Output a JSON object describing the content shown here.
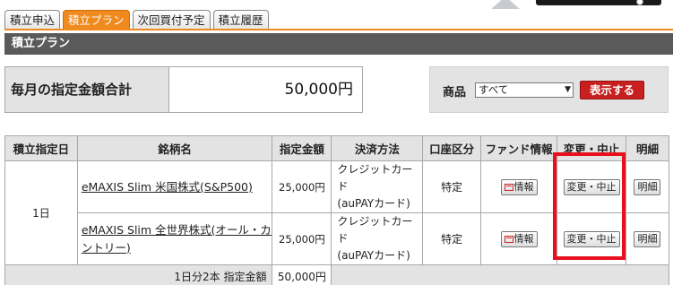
{
  "tabs": [
    {
      "label": "積立申込",
      "active": false
    },
    {
      "label": "積立プラン",
      "active": true
    },
    {
      "label": "次回買付予定",
      "active": false
    },
    {
      "label": "積立履歴",
      "active": false
    }
  ],
  "section_title": "積立プラン",
  "summary": {
    "label": "毎月の指定金額合計",
    "value": "50,000円"
  },
  "filter": {
    "label": "商品",
    "selected": "すべて",
    "button_label": "表示する"
  },
  "table": {
    "headers": [
      "積立指定日",
      "銘柄名",
      "指定金額",
      "決済方法",
      "口座区分",
      "ファンド情報",
      "変更・中止",
      "明細"
    ],
    "day": "1日",
    "rows": [
      {
        "fund": "eMAXIS Slim 米国株式(S&P500)",
        "amount": "25,000円",
        "payment_line1": "クレジットカード",
        "payment_line2": "(auPAYカード)",
        "account": "特定",
        "info_label": "情報",
        "change_label": "変更・中止",
        "detail_label": "明細"
      },
      {
        "fund": "eMAXIS Slim 全世界株式(オール・カントリー)",
        "amount": "25,000円",
        "payment_line1": "クレジットカード",
        "payment_line2": "(auPAYカード)",
        "account": "特定",
        "info_label": "情報",
        "change_label": "変更・中止",
        "detail_label": "明細"
      }
    ],
    "total_label": "1日分2本 指定金額",
    "total_amount": "50,000円"
  },
  "colors": {
    "tab_active": "#f08a1f",
    "header_bar": "#5a5a5a",
    "show_button": "#c81f1f",
    "highlight": "#e8101d",
    "cell_bg": "#e3e3e3"
  }
}
